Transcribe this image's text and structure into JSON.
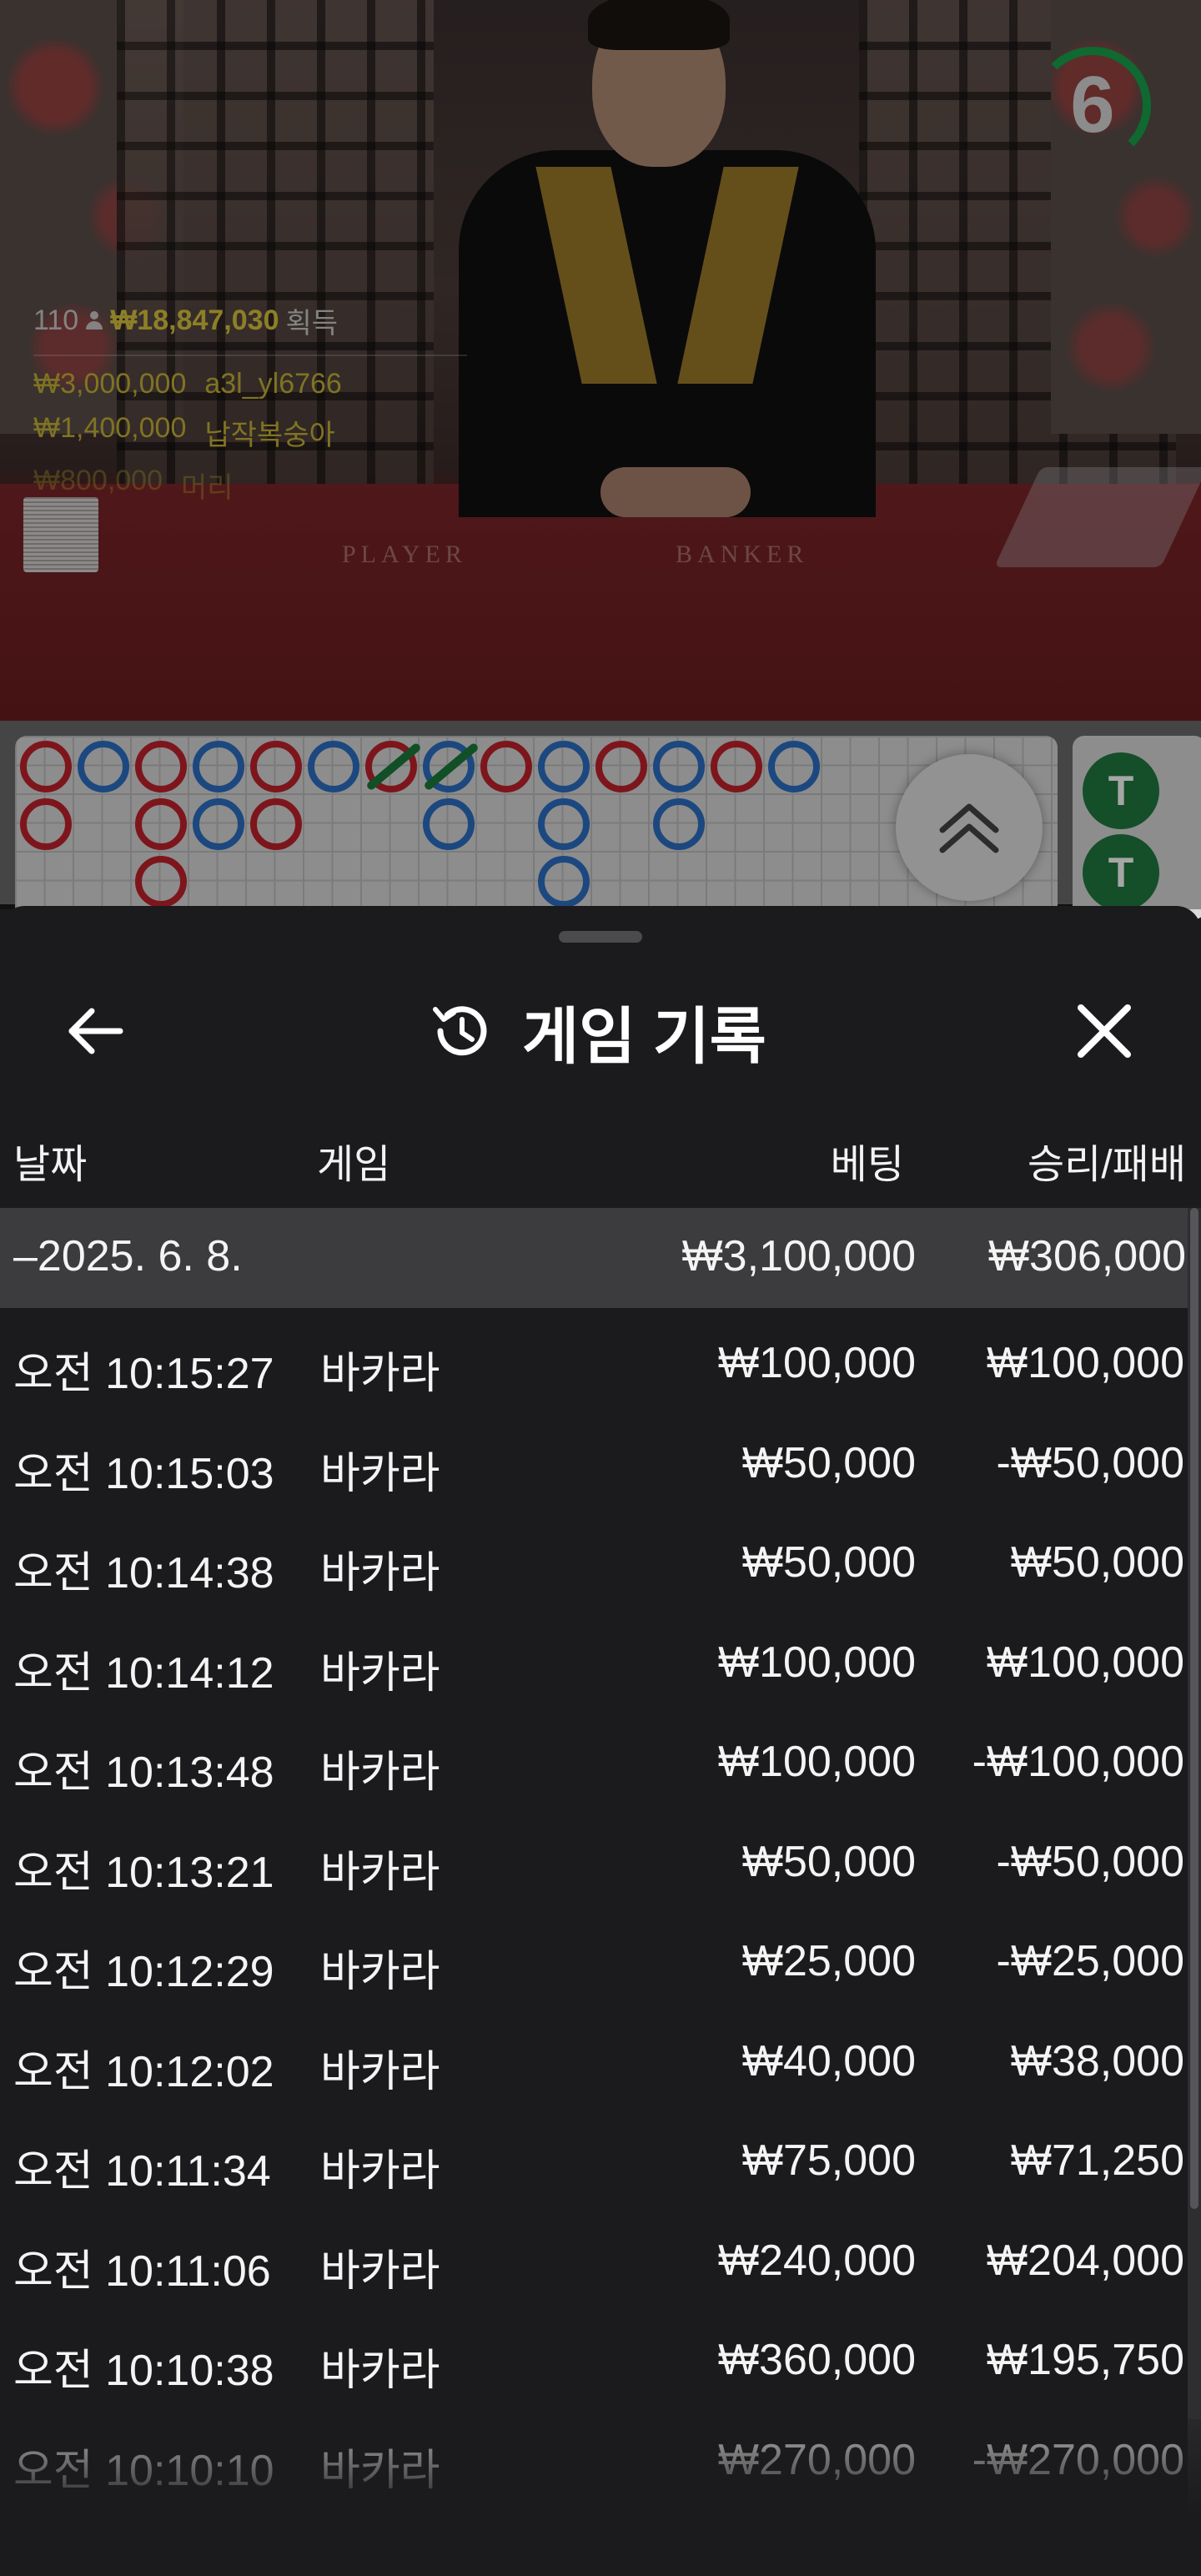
{
  "video": {
    "countdown": "6",
    "felt_player": "PLAYER",
    "felt_banker": "BANKER"
  },
  "winners": {
    "count": "110",
    "total": "₩18,847,030",
    "total_suffix": "획득",
    "list": [
      {
        "amount": "₩3,000,000",
        "name": "a3l_yl6766"
      },
      {
        "amount": "₩1,400,000",
        "name": "납작복숭아"
      },
      {
        "amount": "₩800,000",
        "name": "머리"
      }
    ]
  },
  "roadmap": {
    "beads": [
      [
        "red",
        "red",
        null
      ],
      [
        "blue",
        null,
        null
      ],
      [
        "red",
        "red",
        "red"
      ],
      [
        "blue",
        "blue",
        null
      ],
      [
        "red",
        "red",
        null
      ],
      [
        "blue",
        null,
        null
      ],
      [
        "red",
        null,
        null
      ],
      [
        "blue",
        "blue",
        null
      ],
      [
        "red",
        null,
        null
      ],
      [
        "blue",
        "blue",
        "blue"
      ],
      [
        "red",
        null,
        null
      ],
      [
        "blue",
        "blue",
        null
      ],
      [
        "red",
        null,
        null
      ],
      [
        "blue",
        null,
        null
      ]
    ],
    "tie_label": "T"
  },
  "sheet": {
    "title": "게임 기록",
    "columns": {
      "date": "날짜",
      "game": "게임",
      "bet": "베팅",
      "result": "승리/패배"
    },
    "date_group": {
      "label": "–2025. 6. 8.",
      "bet": "₩3,100,000",
      "result": "₩306,000"
    },
    "rows": [
      {
        "time": "오전 10:15:27",
        "game": "바카라",
        "bet": "₩100,000",
        "result": "₩100,000"
      },
      {
        "time": "오전 10:15:03",
        "game": "바카라",
        "bet": "₩50,000",
        "result": "-₩50,000"
      },
      {
        "time": "오전 10:14:38",
        "game": "바카라",
        "bet": "₩50,000",
        "result": "₩50,000"
      },
      {
        "time": "오전 10:14:12",
        "game": "바카라",
        "bet": "₩100,000",
        "result": "₩100,000"
      },
      {
        "time": "오전 10:13:48",
        "game": "바카라",
        "bet": "₩100,000",
        "result": "-₩100,000"
      },
      {
        "time": "오전 10:13:21",
        "game": "바카라",
        "bet": "₩50,000",
        "result": "-₩50,000"
      },
      {
        "time": "오전 10:12:29",
        "game": "바카라",
        "bet": "₩25,000",
        "result": "-₩25,000"
      },
      {
        "time": "오전 10:12:02",
        "game": "바카라",
        "bet": "₩40,000",
        "result": "₩38,000"
      },
      {
        "time": "오전 10:11:34",
        "game": "바카라",
        "bet": "₩75,000",
        "result": "₩71,250"
      },
      {
        "time": "오전 10:11:06",
        "game": "바카라",
        "bet": "₩240,000",
        "result": "₩204,000"
      },
      {
        "time": "오전 10:10:38",
        "game": "바카라",
        "bet": "₩360,000",
        "result": "₩195,750"
      },
      {
        "time": "오전 10:10:10",
        "game": "바카라",
        "bet": "₩270,000",
        "result": "-₩270,000"
      }
    ]
  },
  "icons": {
    "back": "arrow-left-icon",
    "close": "close-icon",
    "history": "history-icon",
    "expand": "chevron-double-up-icon"
  }
}
